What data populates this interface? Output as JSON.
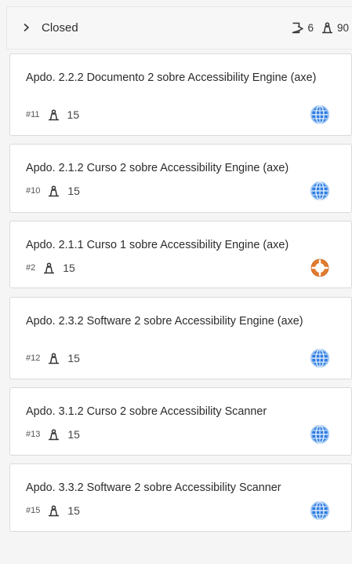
{
  "column": {
    "title": "Closed",
    "task_count": "6",
    "points_total": "90"
  },
  "colors": {
    "globe_blue": "#2f7de1",
    "ring_orange": "#e07b2e"
  },
  "cards": [
    {
      "title": "Apdo. 2.2.2 Documento 2 sobre Accessibility Engine (axe)",
      "id": "#11",
      "points": "15",
      "status_icon": "globe-icon"
    },
    {
      "title": "Apdo. 2.1.2 Curso 2 sobre Accessibility Engine (axe)",
      "id": "#10",
      "points": "15",
      "status_icon": "globe-icon"
    },
    {
      "title": "Apdo. 2.1.1 Curso 1 sobre Accessibility Engine (axe)",
      "id": "#2",
      "points": "15",
      "status_icon": "lifebuoy-icon"
    },
    {
      "title": "Apdo. 2.3.2 Software 2 sobre Accessibility Engine (axe)",
      "id": "#12",
      "points": "15",
      "status_icon": "globe-icon"
    },
    {
      "title": "Apdo. 3.1.2 Curso 2 sobre Accessibility Scanner",
      "id": "#13",
      "points": "15",
      "status_icon": "globe-icon"
    },
    {
      "title": "Apdo. 3.3.2 Software 2 sobre Accessibility Scanner",
      "id": "#15",
      "points": "15",
      "status_icon": "globe-icon"
    }
  ]
}
